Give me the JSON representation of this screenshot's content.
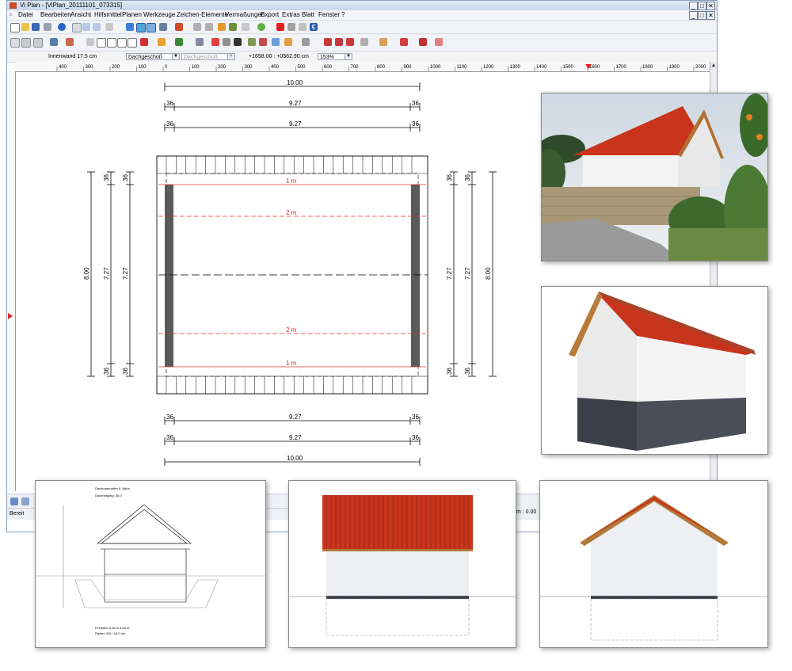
{
  "window": {
    "title": "Vi Plan - [ViPlan_20111101_073315]",
    "controls": [
      "_",
      "Ź",
      "X"
    ]
  },
  "menu": [
    "Datei",
    "Bearbeiten",
    "Ansicht",
    "Hilfsmittel",
    "Planen",
    "Werkzeuge",
    "Zeichen-Elemente",
    "Vermaßungen",
    "Export",
    "Extras",
    "Blatt",
    "Fenster",
    "?"
  ],
  "propbar": {
    "wall": "Innenwand 17.5 cm",
    "floor1": "Dachgeschoß",
    "floor2": "Dachgeschoß",
    "coords": "+1658.00 : +0562.90 cm",
    "zoom": "153%"
  },
  "ruler": {
    "labels": [
      "400",
      "300",
      "200",
      "100",
      "0",
      "100",
      "200",
      "300",
      "400",
      "500",
      "600",
      "700",
      "800",
      "900",
      "1000",
      "1100",
      "1200",
      "1300",
      "1400",
      "1500",
      "1600",
      "1700",
      "1800",
      "1900",
      "2000",
      "2100"
    ]
  },
  "plan": {
    "top_total": "10.00",
    "top_inner_1": "9.27",
    "top_inner_2": "9.27",
    "bottom_inner_1": "9.27",
    "bottom_inner_2": "9.27",
    "bottom_total": "10.00",
    "small_dim": "36",
    "left_total": "8.00",
    "left_inner_1": "7.27",
    "left_inner_2": "7.27",
    "right_inner_1": "7.27",
    "right_inner_2": "7.27",
    "right_total": "8.00",
    "line_1m_top": "1 m",
    "line_2m_top": "2 m",
    "line_2m_bottom": "2 m",
    "line_1m_bottom": "1 m"
  },
  "status": {
    "left": "Bereit",
    "right": "m : 0.00 qm"
  },
  "section": {
    "heading": "Dachmaterialien 6. Bahn",
    "sub": "Dachneigung: 36.0",
    "foot1": "Firsthöhe 0.28 m 8.64 m",
    "foot2": "Pfetten 200 / 18.0 cm"
  },
  "colors": {
    "roof": "#c8341c",
    "wall_gray": "#5a5a5a",
    "dim_red": "#e03030",
    "base": "#3b3f48"
  }
}
